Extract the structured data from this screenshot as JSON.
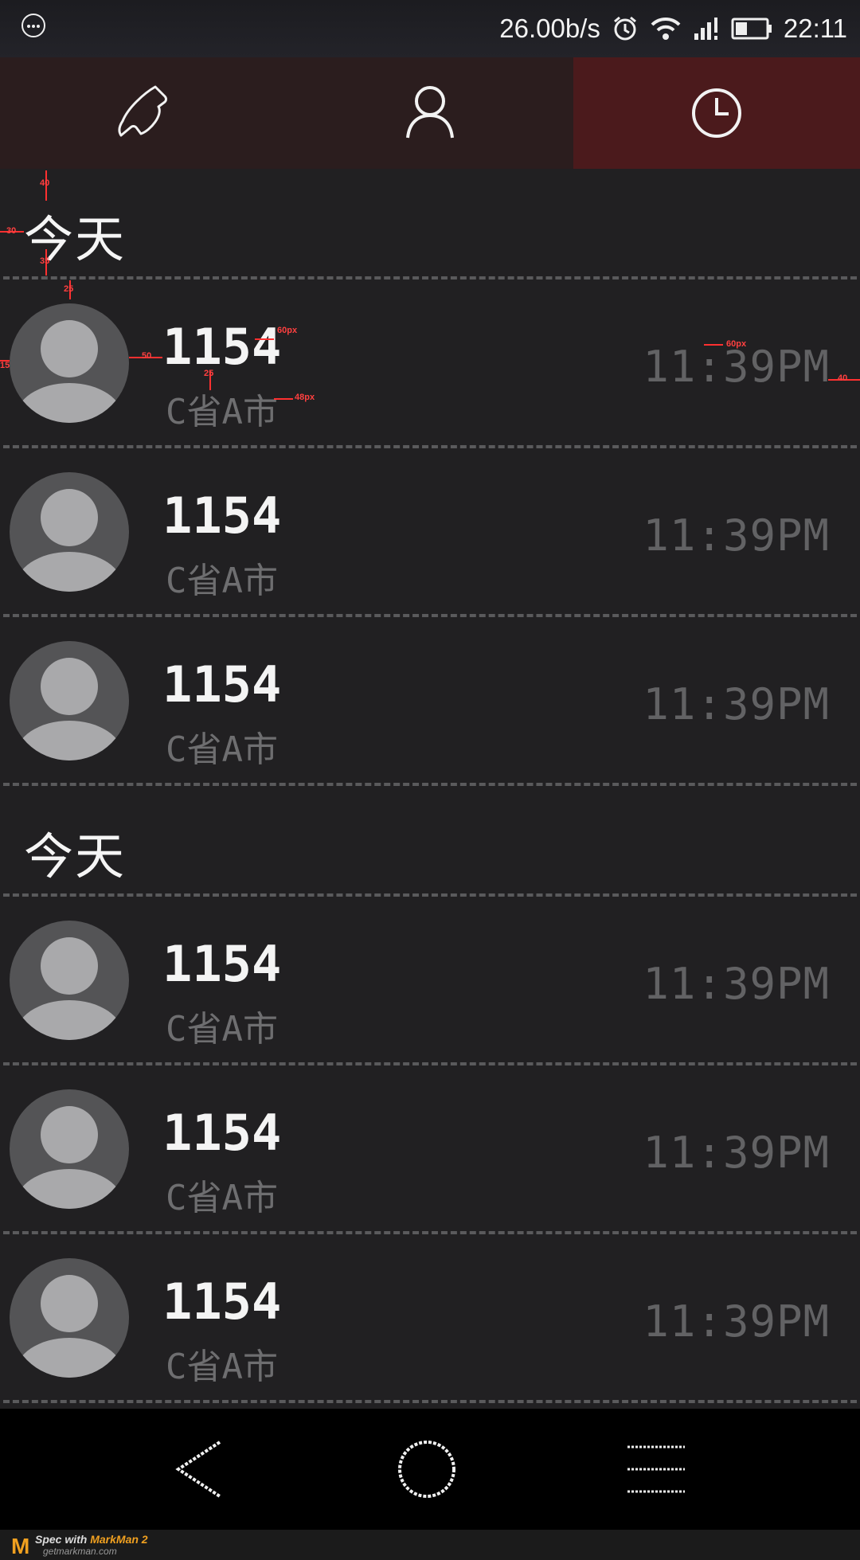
{
  "status_bar": {
    "speed": "26.00b/s",
    "time": "22:11",
    "icons": [
      "menu-dots-icon",
      "alarm-icon",
      "wifi-icon",
      "signal-icon",
      "battery-icon"
    ]
  },
  "tabs": [
    {
      "name": "phone",
      "icon": "phone-icon",
      "active": false
    },
    {
      "name": "contacts",
      "icon": "person-icon",
      "active": false
    },
    {
      "name": "recents",
      "icon": "clock-icon",
      "active": true
    }
  ],
  "sections": [
    {
      "title": "今天",
      "calls": [
        {
          "number": "1154",
          "location": "C省A市",
          "time": "11:39PM"
        },
        {
          "number": "1154",
          "location": "C省A市",
          "time": "11:39PM"
        },
        {
          "number": "1154",
          "location": "C省A市",
          "time": "11:39PM"
        }
      ]
    },
    {
      "title": "今天",
      "calls": [
        {
          "number": "1154",
          "location": "C省A市",
          "time": "11:39PM"
        },
        {
          "number": "1154",
          "location": "C省A市",
          "time": "11:39PM"
        },
        {
          "number": "1154",
          "location": "C省A市",
          "time": "11:39PM"
        }
      ]
    }
  ],
  "spec_marks": {
    "header_top": "40",
    "header_left": "30",
    "header_bottom": "35",
    "avatar_top": "25",
    "avatar_left": "15",
    "avatar_gap": "50",
    "number_size": "60px",
    "line_gap": "25",
    "location_size": "48px",
    "time_size": "60px",
    "time_right": "40"
  },
  "nav_bar": {
    "icons": [
      "back-icon",
      "home-icon",
      "menu-icon"
    ]
  },
  "footer": {
    "logo": "M",
    "brand_prefix": "Spec with ",
    "brand": "MarkMan 2",
    "site": "getmarkman.com"
  },
  "colors": {
    "tab_bg": "#2b1d1e",
    "tab_active": "#4b1a1c",
    "list_bg": "#212022"
  }
}
